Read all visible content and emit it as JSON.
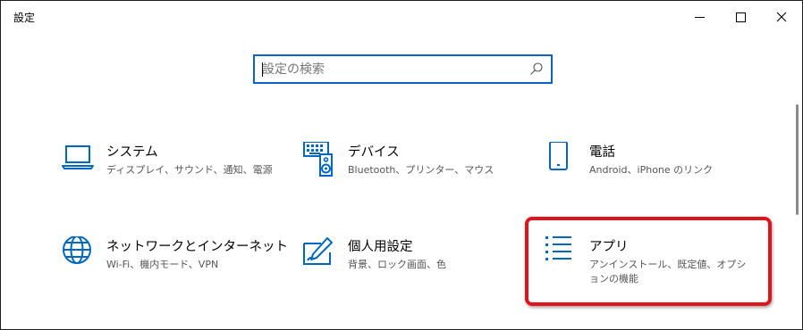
{
  "window": {
    "title": "設定",
    "controls": {
      "minimize": "minimize-icon",
      "maximize": "maximize-icon",
      "close": "close-icon"
    }
  },
  "search": {
    "placeholder": "設定の検索",
    "value": "",
    "icon": "search-icon"
  },
  "categories": [
    {
      "name": "システム",
      "desc": "ディスプレイ、サウンド、通知、電源",
      "icon": "laptop-icon"
    },
    {
      "name": "デバイス",
      "desc": "Bluetooth、プリンター、マウス",
      "icon": "keyboard-speaker-icon"
    },
    {
      "name": "電話",
      "desc": "Android、iPhone のリンク",
      "icon": "phone-icon"
    },
    {
      "name": "ネットワークとインターネット",
      "desc": "Wi-Fi、機内モード、VPN",
      "icon": "globe-icon"
    },
    {
      "name": "個人用設定",
      "desc": "背景、ロック画面、色",
      "icon": "paint-pen-icon"
    },
    {
      "name": "アプリ",
      "desc": "アンインストール、既定値、オプションの機能",
      "icon": "app-list-icon"
    }
  ],
  "colors": {
    "accent": "#0b63c4",
    "icon": "#0067c0",
    "highlight": "#e0141a"
  }
}
